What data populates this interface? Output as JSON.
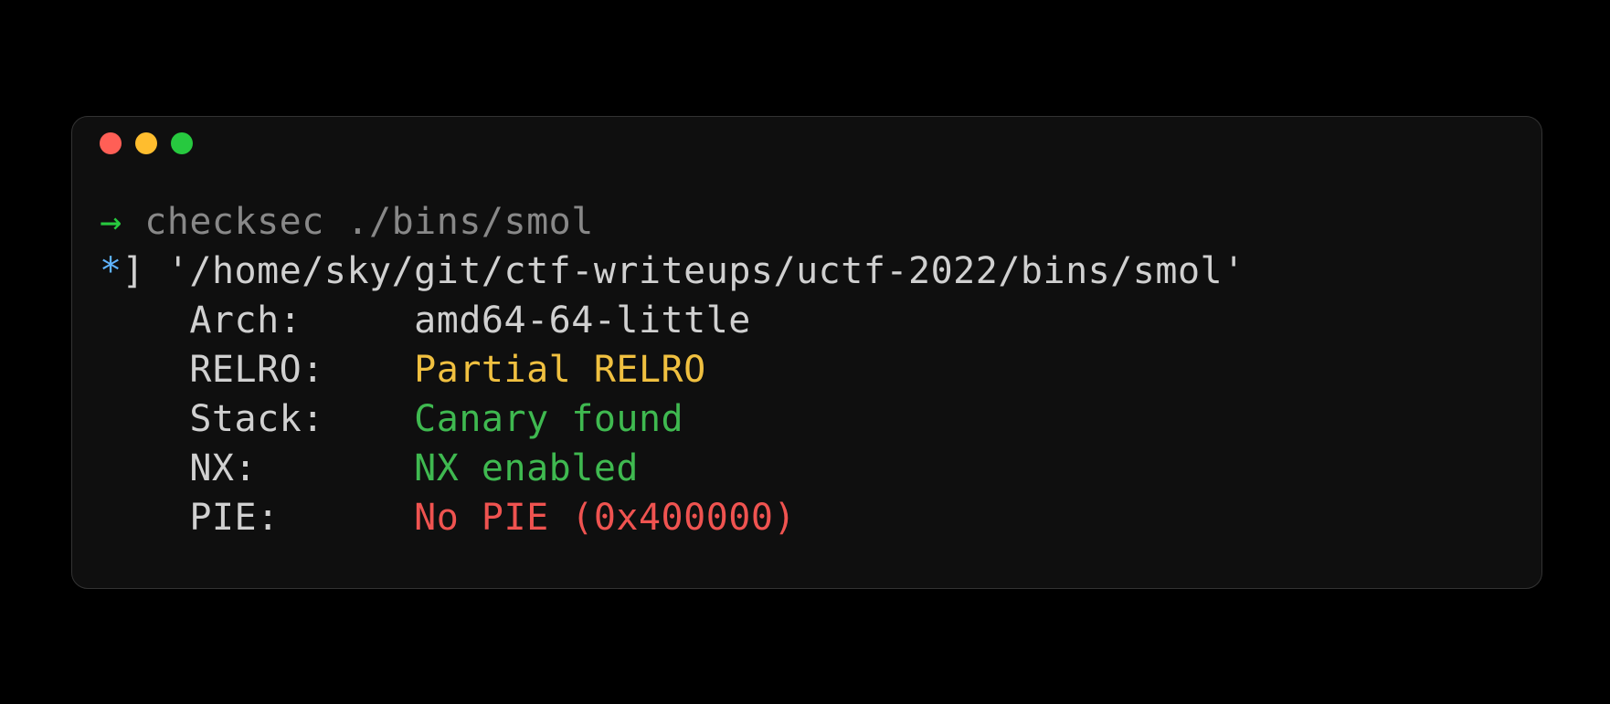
{
  "prompt": {
    "arrow": "→",
    "command": "checksec ./bins/smol"
  },
  "output": {
    "marker_star": "*",
    "marker_bracket": "]",
    "path": "'/home/sky/git/ctf-writeups/uctf-2022/bins/smol'",
    "fields": [
      {
        "label": "Arch:",
        "value": "amd64-64-little",
        "color": "default"
      },
      {
        "label": "RELRO:",
        "value": "Partial RELRO",
        "color": "yellow"
      },
      {
        "label": "Stack:",
        "value": "Canary found",
        "color": "green"
      },
      {
        "label": "NX:",
        "value": "NX enabled",
        "color": "green"
      },
      {
        "label": "PIE:",
        "value": "No PIE (0x400000)",
        "color": "red"
      }
    ]
  }
}
